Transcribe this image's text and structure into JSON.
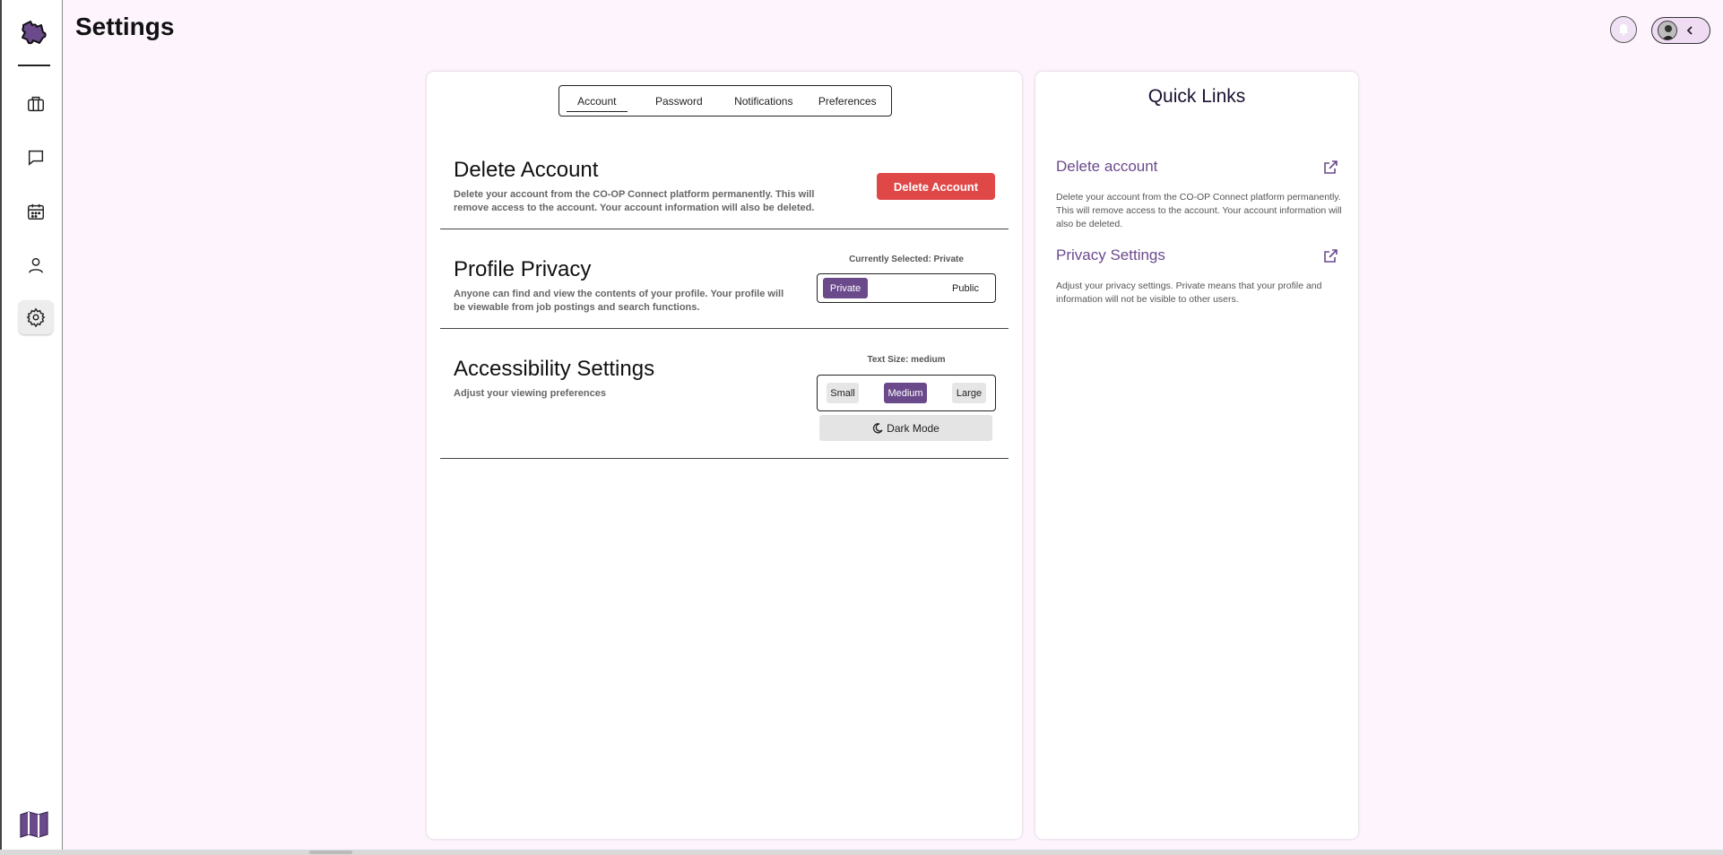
{
  "page": {
    "title": "Settings"
  },
  "sidebar": {
    "items": [
      {
        "name": "briefcase-icon"
      },
      {
        "name": "chat-icon"
      },
      {
        "name": "calendar-icon"
      },
      {
        "name": "person-icon"
      },
      {
        "name": "gear-icon",
        "active": true
      }
    ]
  },
  "tabs": [
    {
      "label": "Account",
      "active": true
    },
    {
      "label": "Password"
    },
    {
      "label": "Notifications"
    },
    {
      "label": "Preferences"
    }
  ],
  "delete_account": {
    "title": "Delete Account",
    "description": "Delete your account from the CO-OP Connect platform permanently. This will remove access to the account. Your account information will also be deleted.",
    "button_label": "Delete Account"
  },
  "profile_privacy": {
    "title": "Profile Privacy",
    "description": "Anyone can find and view the contents of your profile. Your profile will be viewable from job postings and search functions.",
    "caption": "Currently Selected: Private",
    "option_private": "Private",
    "option_public": "Public"
  },
  "accessibility": {
    "title": "Accessibility Settings",
    "description": "Adjust your viewing preferences",
    "caption": "Text Size: medium",
    "size_small": "Small",
    "size_medium": "Medium",
    "size_large": "Large",
    "dark_mode_label": "Dark Mode"
  },
  "quick_links": {
    "title": "Quick Links",
    "items": [
      {
        "title": "Delete account",
        "description": "Delete your account from the CO-OP Connect platform permanently. This will remove access to the account. Your account information will also be deleted."
      },
      {
        "title": "Privacy Settings",
        "description": "Adjust your privacy settings. Private means that your profile and information will not be visible to other users."
      }
    ]
  },
  "colors": {
    "accent": "#6b4a8c",
    "danger": "#e04848",
    "background": "#fdf4fd"
  }
}
